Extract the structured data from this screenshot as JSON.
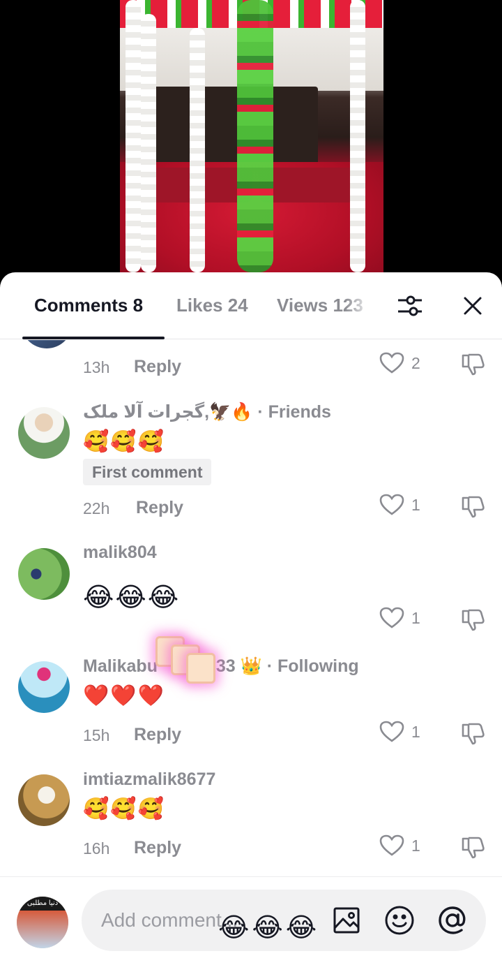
{
  "tabs": {
    "comments": "Comments 8",
    "likes": "Likes 24",
    "views": "Views 123"
  },
  "comments": [
    {
      "time": "13h",
      "reply": "Reply",
      "likes": "2"
    },
    {
      "username": "گجرات آلا ملک,🦅",
      "username_prefix": "🔥",
      "tag": " · Friends",
      "text": "🥰🥰🥰",
      "chip": "First comment",
      "time": "22h",
      "reply": "Reply",
      "likes": "1"
    },
    {
      "username": "malik804",
      "text": "😂😂😂",
      "likes": "1"
    },
    {
      "username": "Malikabu",
      "username_rest": "333",
      "crown": "👑",
      "tag": " · Following",
      "text": "❤️❤️❤️",
      "time": "15h",
      "reply": "Reply",
      "likes": "1"
    },
    {
      "username": "imtiazmalik8677",
      "text": "🥰🥰🥰",
      "time": "16h",
      "reply": "Reply",
      "likes": "1"
    }
  ],
  "composer": {
    "placeholder": "Add comment...",
    "floating_emojis": "😂😂😂",
    "avatar_caption": "دنیا مطلبی"
  },
  "icons": {
    "filter": "sliders-icon",
    "close": "close-icon",
    "like": "heart-outline-icon",
    "dislike": "thumbs-down-icon",
    "image": "image-icon",
    "emoji": "smiley-icon",
    "mention": "at-sign-icon"
  },
  "colors": {
    "text_primary": "#161823",
    "text_secondary": "#8a8b91",
    "sheet_bg": "#ffffff",
    "pill_bg": "#f1f1f2"
  }
}
